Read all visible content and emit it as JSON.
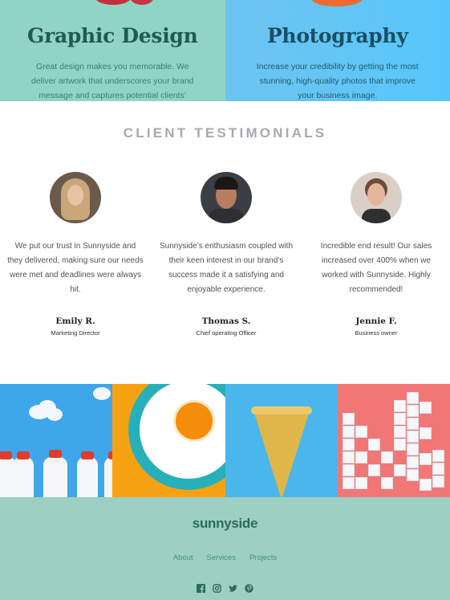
{
  "services": [
    {
      "title": "Graphic Design",
      "text": "Great design makes you memorable. We deliver artwork that underscores your brand message and captures potential clients’ attention."
    },
    {
      "title": "Photography",
      "text": "Increase your credibility by getting the most stunning, high-quality photos that improve your business image."
    }
  ],
  "testimonials": {
    "heading": "CLIENT TESTIMONIALS",
    "items": [
      {
        "quote": "We put our trust in Sunnyside and they delivered, making sure our needs were met and deadlines were always hit.",
        "name": "Emily R.",
        "role": "Marketing Director"
      },
      {
        "quote": "Sunnyside’s enthusiasm coupled with their keen interest in our brand’s success made it a satisfying and enjoyable experience.",
        "name": "Thomas S.",
        "role": "Chief operating Officer"
      },
      {
        "quote": "Incredible end result! Our sales increased over 400% when we worked with Sunnyside. Highly recommended!",
        "name": "Jennie F.",
        "role": "Business owner"
      }
    ]
  },
  "gallery": [
    "milk-bottles-image",
    "orange-plate-image",
    "ice-cream-cone-image",
    "sugar-cubes-image"
  ],
  "footer": {
    "logo": "sunnyside",
    "nav": [
      "About",
      "Services",
      "Projects"
    ],
    "social_icons": [
      "facebook-icon",
      "instagram-icon",
      "twitter-icon",
      "pinterest-icon"
    ]
  },
  "colors": {
    "graphic_design_bg": "#90d4c5",
    "photography_bg": "#56c7fb",
    "footer_bg": "#9dcfc2",
    "footer_text": "#2c6a5b"
  }
}
